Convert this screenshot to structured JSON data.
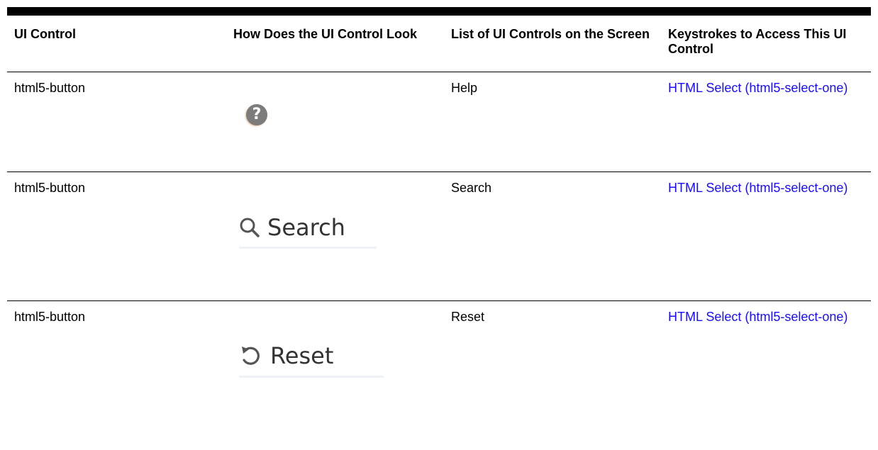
{
  "table": {
    "headers": [
      "UI Control",
      "How Does the UI Control Look",
      "List of UI Controls on the Screen",
      "Keystrokes to Access This UI Control"
    ],
    "rows": [
      {
        "control": "html5-button",
        "look": {
          "icon": "help-icon",
          "label": "?"
        },
        "list": "Help",
        "keystrokes": "HTML Select (html5-select-one)"
      },
      {
        "control": "html5-button",
        "look": {
          "icon": "search-icon",
          "label": "Search"
        },
        "list": "Search",
        "keystrokes": "HTML Select (html5-select-one)"
      },
      {
        "control": "html5-button",
        "look": {
          "icon": "reset-icon",
          "label": "Reset"
        },
        "list": "Reset",
        "keystrokes": "HTML Select (html5-select-one)"
      }
    ]
  },
  "colors": {
    "link": "#1a0dff",
    "rule": "#000000",
    "help_icon_bg": "#7c7c7c"
  }
}
